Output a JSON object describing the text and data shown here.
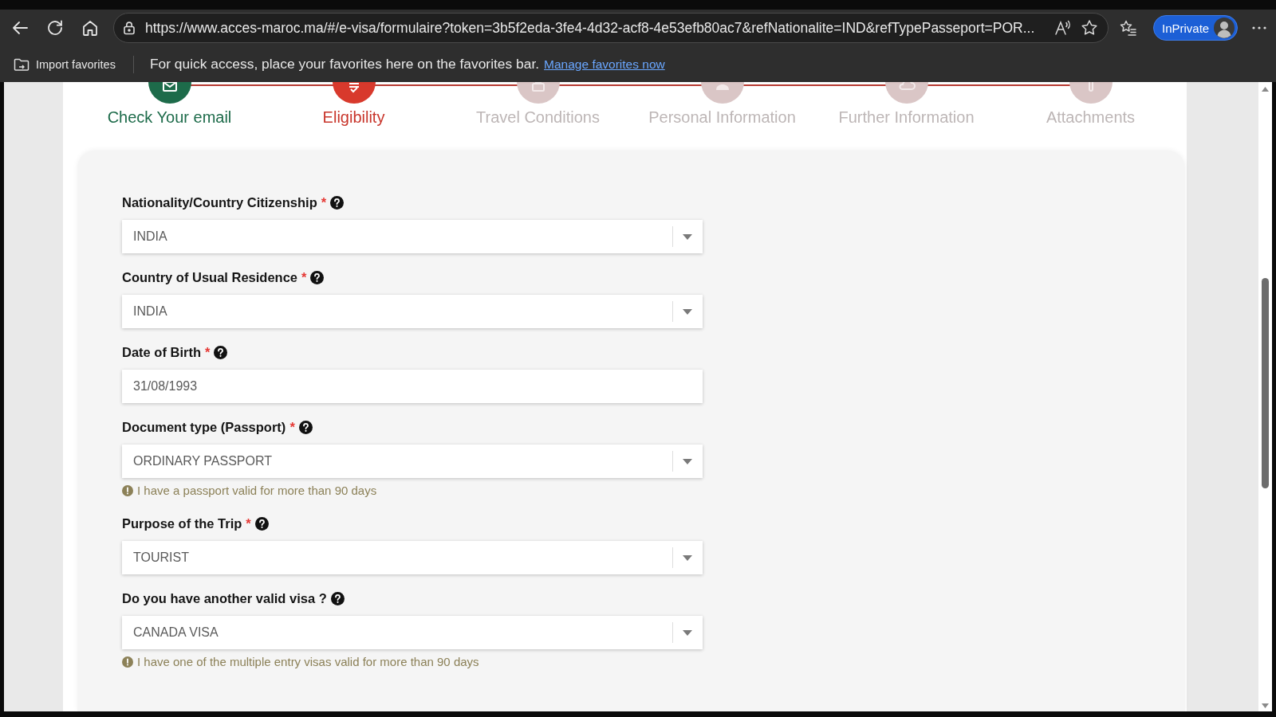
{
  "browser": {
    "url": "https://www.acces-maroc.ma/#/e-visa/formulaire?token=3b5f2eda-3fe4-4d32-acf8-4e53efb80ac7&refNationalite=IND&refTypePasseport=POR...",
    "profile_label": "InPrivate"
  },
  "favorites_bar": {
    "import_label": "Import favorites",
    "message": "For quick access, place your favorites here on the favorites bar.",
    "link": "Manage favorites now"
  },
  "steps": [
    {
      "label": "Check Your email",
      "completed": true,
      "selected": false
    },
    {
      "label": "Eligibility",
      "completed": false,
      "selected": true
    },
    {
      "label": "Travel Conditions",
      "completed": false,
      "selected": false
    },
    {
      "label": "Personal Information",
      "completed": false,
      "selected": false
    },
    {
      "label": "Further Information",
      "completed": false,
      "selected": false
    },
    {
      "label": "Attachments",
      "completed": false,
      "selected": false
    }
  ],
  "fields": [
    {
      "kind": "select",
      "label": "Nationality/Country Citizenship",
      "required_mark": "*",
      "value": "INDIA"
    },
    {
      "kind": "select",
      "label": "Country of Usual Residence",
      "required_mark": "*",
      "value": "INDIA"
    },
    {
      "kind": "text",
      "label": "Date of Birth",
      "required_mark": "*",
      "value": "31/08/1993"
    },
    {
      "kind": "select",
      "label": "Document type (Passport)",
      "required_mark": "*",
      "value": "ORDINARY PASSPORT",
      "hint": "I have a passport valid for more than 90 days"
    },
    {
      "kind": "select",
      "label": "Purpose of the Trip",
      "required_mark": "*",
      "value": "TOURIST"
    },
    {
      "kind": "select",
      "label": "Do you have another valid visa ?",
      "value": "CANADA VISA",
      "hint": "I have one of the multiple entry visas valid for more than 90 days"
    }
  ]
}
